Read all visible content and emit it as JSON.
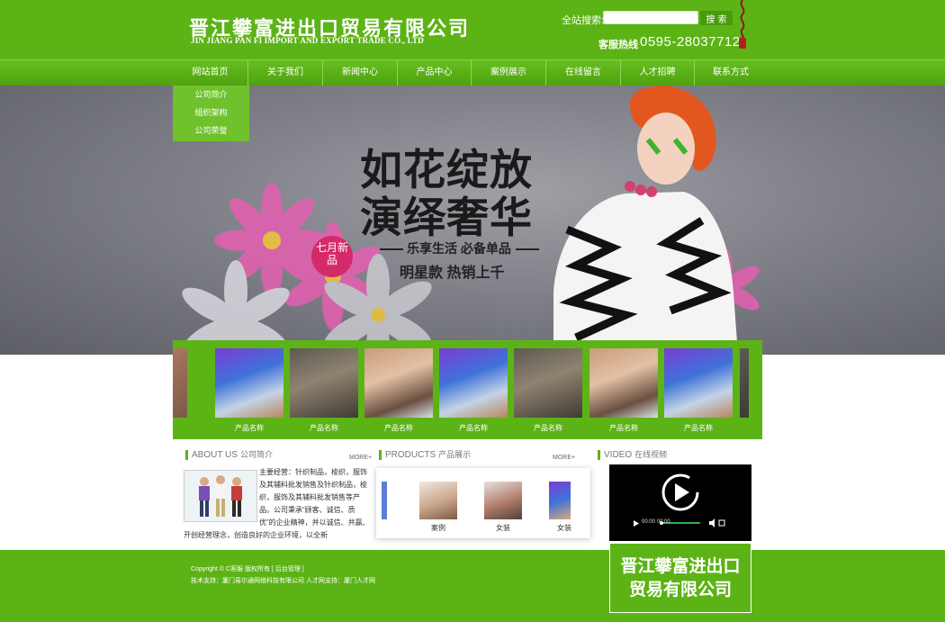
{
  "header": {
    "company_cn": "晋江攀富进出口贸易有限公司",
    "company_en": "JIN JIANG PAN FI IMPORT AND EXPORT TRADE CO., LTD",
    "search_label": "全站搜索:",
    "search_value": "",
    "search_button": "搜 索",
    "hotline_label": "客服热线",
    "hotline_number": "0595-28037712"
  },
  "nav": {
    "items": [
      "网站首页",
      "关于我们",
      "新闻中心",
      "产品中心",
      "案例展示",
      "在线留言",
      "人才招聘",
      "联系方式"
    ]
  },
  "submenu": {
    "items": [
      "公司简介",
      "组织架构",
      "公司荣誉"
    ]
  },
  "banner": {
    "seal": "七月新品",
    "line1": "如花绽放",
    "line2": "演绎奢华",
    "line3": "乐享生活  必备单品",
    "line4": "明星款  热销上千"
  },
  "gallery": {
    "captions": [
      "产品名称",
      "产品名称",
      "产品名称",
      "产品名称",
      "产品名称",
      "产品名称",
      "产品名称"
    ]
  },
  "about": {
    "title": "ABOUT US",
    "subtitle": "公司简介",
    "more": "MORE+",
    "text": "主要经营：针织制品，梭织，服饰及其辅料批发销售及针织制品，梭织，服饰及其辅料批发销售等产品。公司秉承“顾客、诚信、质优”的企业精神，并以诚信、共赢、开创经营理念，创造良好的企业环境，以全新"
  },
  "products": {
    "title": "PRODUCTS",
    "subtitle": "产品展示",
    "more": "MORE+",
    "captions": [
      "案例",
      "女装",
      "女装"
    ]
  },
  "video": {
    "title": "VIDEO",
    "subtitle": "在线视频",
    "time": "00:00 00:00"
  },
  "footer": {
    "line1": "Copyright © C客服  版权所有  [ 后台管理 ]",
    "line2": "技术支持：厦门易尔通网络科技有限公司 人才网支持：厦门人才网",
    "badge_line1": "晋江攀富进出口",
    "badge_line2": "贸易有限公司"
  },
  "colors": {
    "brand_green": "#5cb316",
    "banner_gray": "#7f8087",
    "seal_pink": "#d52a6a"
  }
}
